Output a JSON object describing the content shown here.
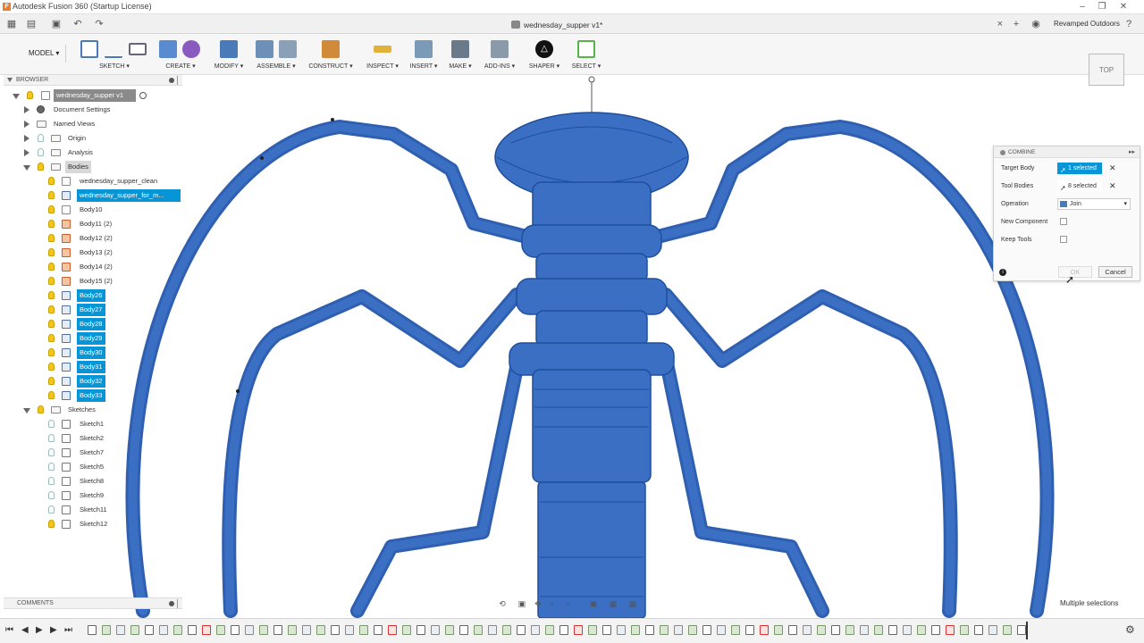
{
  "window": {
    "title": "Autodesk Fusion 360 (Startup License)",
    "app_icon_letter": "F"
  },
  "document_tab": {
    "title": "wednesday_supper v1*",
    "close_label": "×"
  },
  "user": {
    "name": "Revamped Outdoors"
  },
  "toolbar": {
    "workspace": "MODEL",
    "groups": [
      {
        "label": "SKETCH"
      },
      {
        "label": "CREATE"
      },
      {
        "label": "MODIFY"
      },
      {
        "label": "ASSEMBLE"
      },
      {
        "label": "CONSTRUCT"
      },
      {
        "label": "INSPECT"
      },
      {
        "label": "INSERT"
      },
      {
        "label": "MAKE"
      },
      {
        "label": "ADD-INS"
      },
      {
        "label": "SHAPER"
      },
      {
        "label": "SELECT"
      }
    ]
  },
  "browser": {
    "title": "BROWSER",
    "root": "wednesday_supper v1",
    "items": [
      {
        "label": "Document Settings"
      },
      {
        "label": "Named Views"
      },
      {
        "label": "Origin"
      },
      {
        "label": "Analysis"
      },
      {
        "label": "Bodies"
      },
      {
        "label": "wednesday_supper_clean"
      },
      {
        "label": "wednesday_supper_for_m..."
      },
      {
        "label": "Body10"
      },
      {
        "label": "Body11 (2)"
      },
      {
        "label": "Body12 (2)"
      },
      {
        "label": "Body13 (2)"
      },
      {
        "label": "Body14 (2)"
      },
      {
        "label": "Body15 (2)"
      },
      {
        "label": "Body26"
      },
      {
        "label": "Body27"
      },
      {
        "label": "Body28"
      },
      {
        "label": "Body29"
      },
      {
        "label": "Body30"
      },
      {
        "label": "Body31"
      },
      {
        "label": "Body32"
      },
      {
        "label": "Body33"
      },
      {
        "label": "Sketches"
      },
      {
        "label": "Sketch1"
      },
      {
        "label": "Sketch2"
      },
      {
        "label": "Sketch7"
      },
      {
        "label": "Sketch5"
      },
      {
        "label": "Sketch8"
      },
      {
        "label": "Sketch9"
      },
      {
        "label": "Sketch11"
      },
      {
        "label": "Sketch12"
      }
    ]
  },
  "comments": {
    "title": "COMMENTS"
  },
  "viewcube": {
    "face": "TOP"
  },
  "combine": {
    "title": "COMBINE",
    "target_body_label": "Target Body",
    "target_body_value": "1 selected",
    "tool_bodies_label": "Tool Bodies",
    "tool_bodies_value": "8 selected",
    "operation_label": "Operation",
    "operation_value": "Join",
    "new_component_label": "New Component",
    "new_component_checked": false,
    "keep_tools_label": "Keep Tools",
    "keep_tools_checked": false,
    "ok_label": "OK",
    "cancel_label": "Cancel"
  },
  "status": {
    "text": "Multiple selections"
  },
  "colors": {
    "model_blue": "#3a6fc4",
    "model_dark": "#1f4f9c",
    "selection_blue": "#0696d7",
    "bulb_on": "#f5c518"
  },
  "icons": {
    "finger_icon": "☝",
    "orbit_icon": "⟲",
    "pan_icon": "✥",
    "zoom_icon": "⌕",
    "display_icon": "▣",
    "grid_icon": "▦"
  }
}
